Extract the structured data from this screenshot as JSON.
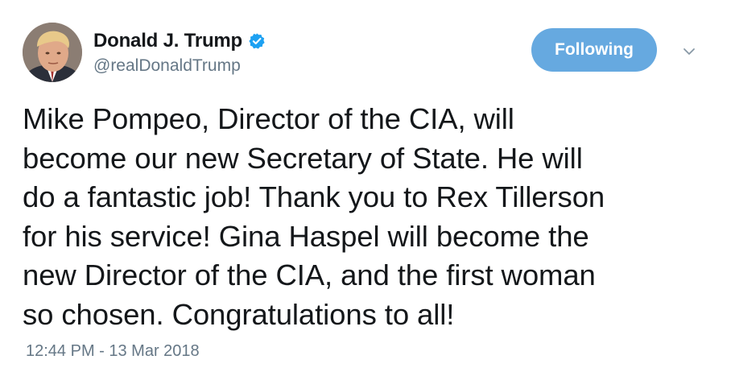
{
  "user": {
    "display_name": "Donald J. Trump",
    "handle": "@realDonaldTrump",
    "verified": true,
    "avatar_icon": "profile-photo"
  },
  "follow_button": {
    "label": "Following",
    "color": "#66a9e0"
  },
  "menu": {
    "icon": "chevron-down-icon"
  },
  "tweet": {
    "text": "Mike Pompeo, Director of the CIA, will\nbecome our new Secretary of State. He will\ndo a fantastic job! Thank you to Rex Tillerson\nfor his service! Gina Haspel will become the\nnew Director of the CIA, and the first woman\nso chosen. Congratulations to all!",
    "timestamp": "12:44 PM - 13 Mar 2018"
  },
  "colors": {
    "text": "#14171a",
    "secondary": "#657786",
    "verified_badge": "#1da1f2"
  }
}
